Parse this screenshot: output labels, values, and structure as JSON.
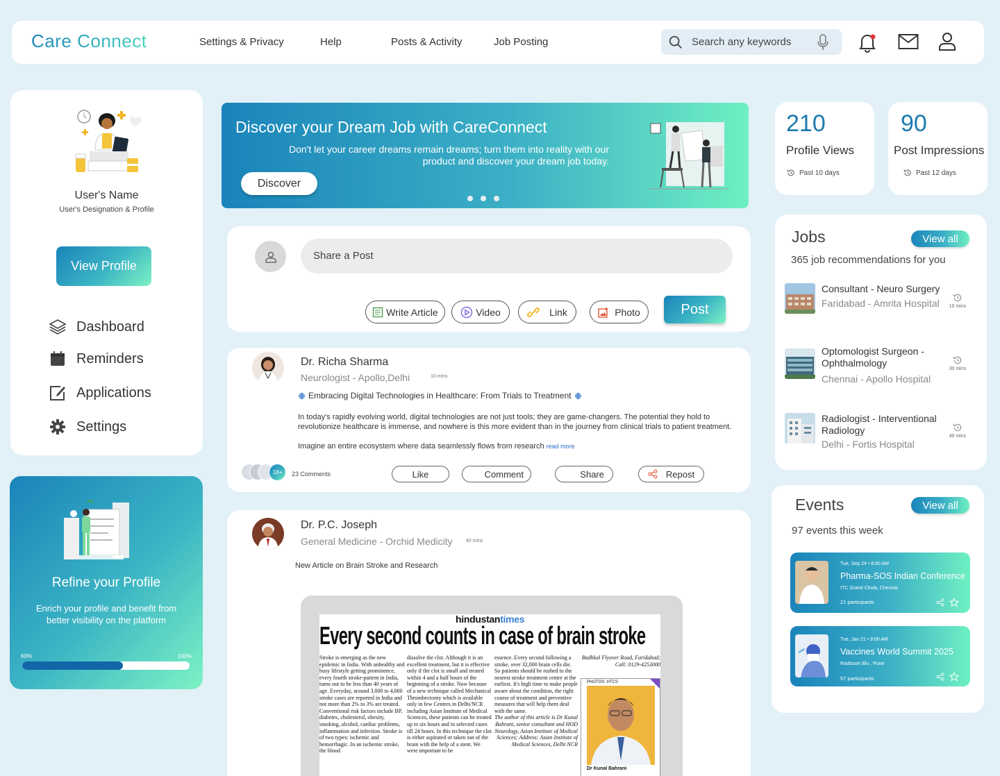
{
  "app": {
    "logo": "Care Connect"
  },
  "nav": {
    "items": [
      "Settings & Privacy",
      "Help",
      "Posts & Activity",
      "Job Posting"
    ]
  },
  "search": {
    "placeholder": "Search any keywords"
  },
  "profile": {
    "name": "User's Name",
    "designation": "User's Designation & Profile",
    "view_button": "View Profile",
    "menu": [
      "Dashboard",
      "Reminders",
      "Applications",
      "Settings"
    ]
  },
  "refine": {
    "title": "Refine your Profile",
    "text": "Enrich your profile and benefit from better visibility on the platform",
    "progress_label": "60%",
    "progress_max_label": "100%",
    "progress_value": 0.6
  },
  "banner": {
    "title": "Discover your Dream Job with CareConnect",
    "text": "Don't let your career dreams remain dreams; turn them into reality with our product and discover your dream job today.",
    "button": "Discover"
  },
  "composer": {
    "placeholder": "Share a Post",
    "actions": [
      "Write Article",
      "Video",
      "Link",
      "Photo"
    ],
    "post_button": "Post"
  },
  "posts": [
    {
      "author": "Dr. Richa Sharma",
      "role": "Neurologist - Apollo,Delhi",
      "time": "10 mins",
      "headline": "Embracing Digital Technologies in Healthcare: From Trials to Treatment",
      "body": "In today's rapidly evolving world, digital technologies are not just tools; they are game-changers. The potential they hold to revolutionize healthcare is immense, and nowhere is this more evident than in the journey from clinical trials to patient treatment.",
      "body2": "Imagine an entire ecosystem where data seamlessly flows from research",
      "read_more": "read more",
      "likers_count": "18+",
      "comments": "23 Comments",
      "actions": [
        "Like",
        "Comment",
        "Share",
        "Repost"
      ]
    },
    {
      "author": "Dr. P.C. Joseph",
      "role": "General Medicine - Orchid Medicity",
      "time": "40 mins",
      "body": "New Article on Brain Stroke and Research",
      "article": {
        "masthead_a": "hindustan",
        "masthead_b": "times",
        "headline": "Every second counts in case of brain stroke",
        "col1": "Stroke is emerging as the new epidemic in India. With unhealthy and busy lifestyle getting prominence, every fourth stroke-patient in India, turns out to be less than 40 years of age. Everyday, around 3,000 to 4,000 stroke cases are reported in India and not more than 2% to 3% are treated. Conventional risk factors include BP, diabetes, cholesterol, obesity, smoking, alcohol, cardiac problems, inflammation and infection. Stroke is of two types: ischemic and hemorrhagic. In an ischemic stroke, the blood",
        "col2": "dissolve the clot. Although it is an excellent treatment, but it is effective only if the clot is small and treated within 4 and a half hours of the beginning of a stroke. Now because of a new technique called Mechanical Thrombectomy which is available only in few Centres in Delhi/NCR including Asian Institute of Medical Sciences, these patients can be treated up to six hours and in selected cases till 24 hours. In this technique the clot is either aspirated or taken out of the brain with the help of a stent. We were important to be",
        "col3": "essence. Every second following a stroke, over 32,000 brain cells die. So patients should be rushed to the nearest stroke treatment centre at the earliest. It's high time to make people aware about the condition, the right course of treatment and preventive measures that will help them deal with the same.",
        "col3_italic": "The author of this article is Dr Kunal Bahrani, senior consultant and HOD Neurology, Asian Institute of Medical Sciences; Address: Asian Institute of Medical Sciences, Delhi NCR",
        "address": "Badhkal Flyover Road, Faridabad; Call: 0129-4253000",
        "photo_credit": "PHOTOS: HTCS",
        "caption": "Dr Kunal Bahrani"
      }
    }
  ],
  "stats": [
    {
      "value": "210",
      "label": "Profile Views",
      "sub": "Past 10 days"
    },
    {
      "value": "90",
      "label": "Post Impressions",
      "sub": "Past 12 days"
    }
  ],
  "jobs": {
    "title": "Jobs",
    "view_all": "View all",
    "subtitle": "365 job recommendations for you",
    "items": [
      {
        "title": "Consultant - Neuro Surgery",
        "location": "Faridabad - Amrita Hospital",
        "time": "10 mins"
      },
      {
        "title": "Optomologist Surgeon  - Ophthalmology",
        "location": "Chennai - Apollo Hospital",
        "time": "30 mins"
      },
      {
        "title": "Radiologist - Interventional Radiology",
        "location": "Delhi - Fortis Hospital",
        "time": "40 mins"
      }
    ]
  },
  "events": {
    "title": "Events",
    "view_all": "View all",
    "subtitle": "97 events this week",
    "items": [
      {
        "date": "Tue, Sep 24 • 8:30 AM",
        "name": "Pharma-SOS Indian Conference",
        "venue": "ITC Grand Chola, Chennai",
        "participants": "21 participants"
      },
      {
        "date": "Tue, Jan 21 • 9:00 AM",
        "name": "Vaccines World Summit 2025",
        "venue": "Radisson Blu , Pune",
        "participants": "57 participants"
      }
    ]
  },
  "colors": {
    "accent": "#1b7ab0",
    "gradient_start": "#1a84ba",
    "gradient_end": "#6ff0c2",
    "page_bg": "#e2f0f8"
  }
}
